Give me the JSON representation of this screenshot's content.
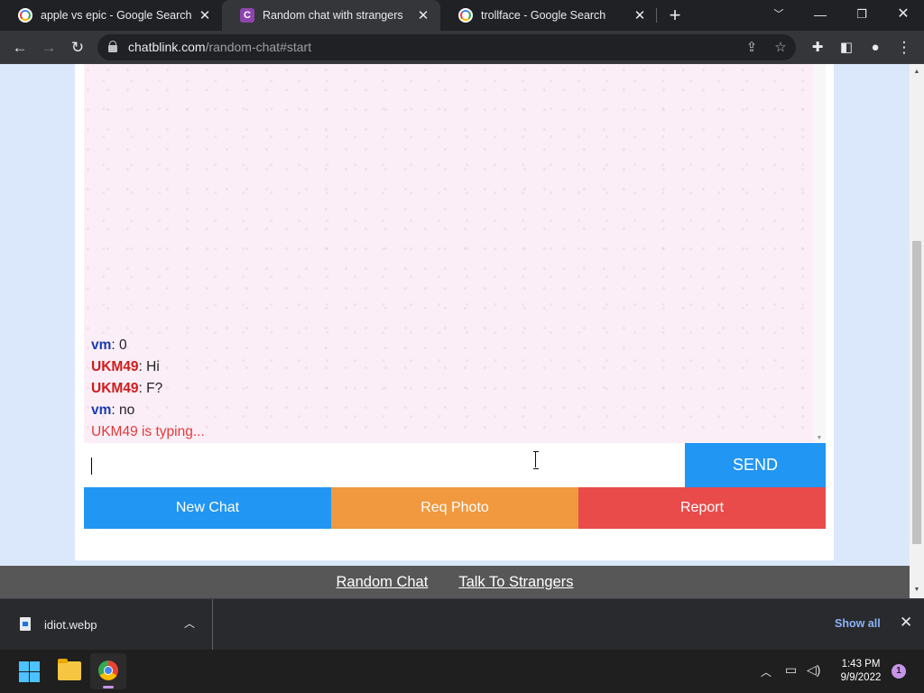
{
  "browser": {
    "tabs": [
      {
        "title": "apple vs epic - Google Search",
        "icon": "google-icon"
      },
      {
        "title": "Random chat with strangers",
        "icon": "chatblink-icon"
      },
      {
        "title": "trollface - Google Search",
        "icon": "google-icon"
      }
    ],
    "active_tab_index": 1,
    "close_glyph": "✕",
    "new_tab_glyph": "+",
    "url_domain": "chatblink.com",
    "url_path": "/random-chat#start",
    "favicon_letter": "C"
  },
  "chat": {
    "messages": [
      {
        "sender": "vm",
        "role": "you",
        "separator": ":",
        "text": " 0"
      },
      {
        "sender": "UKM49",
        "role": "stranger",
        "separator": ":",
        "text": " Hi"
      },
      {
        "sender": "UKM49",
        "role": "stranger",
        "separator": ":",
        "text": " F?"
      },
      {
        "sender": "vm",
        "role": "you",
        "separator": ":",
        "text": " no"
      }
    ],
    "typing_indicator": "UKM49 is typing...",
    "input_value": "",
    "send_label": "SEND",
    "buttons": {
      "new_chat": "New Chat",
      "req_photo": "Req Photo",
      "report": "Report"
    },
    "colors": {
      "you": "#1a3bb0",
      "stranger": "#d01c1c",
      "send": "#2196f3",
      "new_chat": "#2196f3",
      "req_photo": "#f0993e",
      "report": "#e94b4b"
    }
  },
  "footer": {
    "links": [
      "Random Chat",
      "Talk To Strangers"
    ]
  },
  "downloads": {
    "file_name": "idiot.webp",
    "show_all": "Show all"
  },
  "taskbar": {
    "time": "1:43 PM",
    "date": "9/9/2022",
    "notification_count": "1"
  }
}
